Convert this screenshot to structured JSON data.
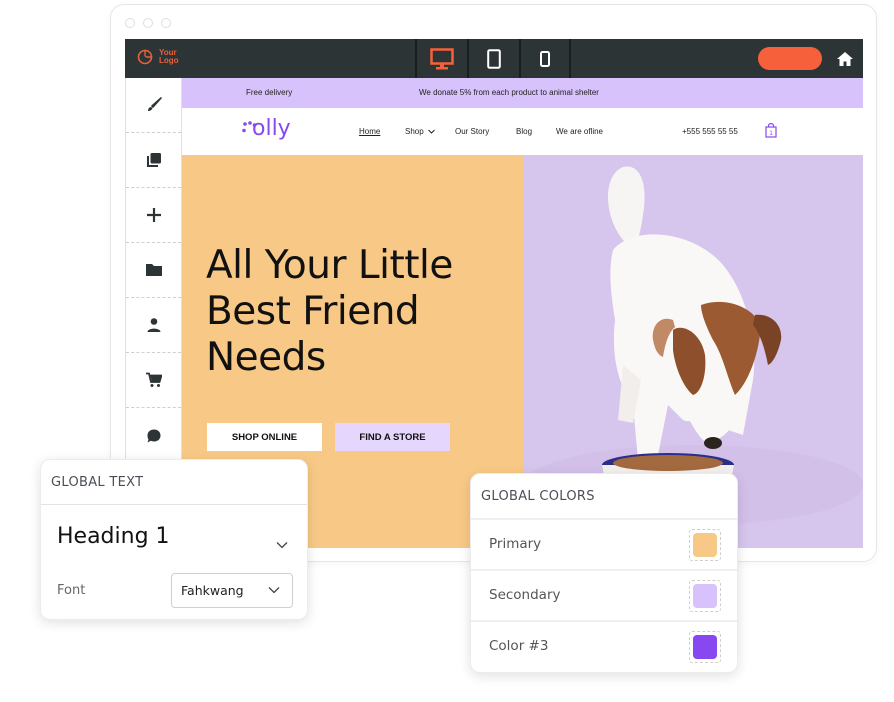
{
  "editor": {
    "logo_text_line1": "Your",
    "logo_text_line2": "Logo",
    "devices": [
      {
        "name": "desktop",
        "active": true
      },
      {
        "name": "tablet",
        "active": false
      },
      {
        "name": "mobile",
        "active": false
      }
    ],
    "publish_label": "",
    "home_icon": "home-icon",
    "tools": [
      "paintbrush-icon",
      "layers-icon",
      "plus-icon",
      "folder-icon",
      "person-icon",
      "cart-icon",
      "chat-icon"
    ],
    "accent_color": "#f6603a",
    "bar_color": "#2d3436"
  },
  "site": {
    "announcement": {
      "left": "Free delivery",
      "center": "We donate 5% from each product to animal shelter"
    },
    "brand": "olly",
    "nav": {
      "items": [
        "Home",
        "Shop",
        "Our Story",
        "Blog",
        "We are ofline"
      ],
      "phone": "+555 555 55 55",
      "cart_count": "1"
    },
    "hero": {
      "headline_lines": [
        "All Your Little",
        "Best Friend",
        "Needs"
      ],
      "primary_button": "SHOP ONLINE",
      "secondary_button": "FIND A STORE"
    }
  },
  "global_text": {
    "title": "GLOBAL TEXT",
    "selected_style": "Heading 1",
    "font_label": "Font",
    "font_value": "Fahkwang"
  },
  "global_colors": {
    "title": "GLOBAL COLORS",
    "colors": [
      {
        "label": "Primary",
        "hex": "#f8c986"
      },
      {
        "label": "Secondary",
        "hex": "#d8c2fc"
      },
      {
        "label": "Color #3",
        "hex": "#8748f0"
      }
    ]
  }
}
